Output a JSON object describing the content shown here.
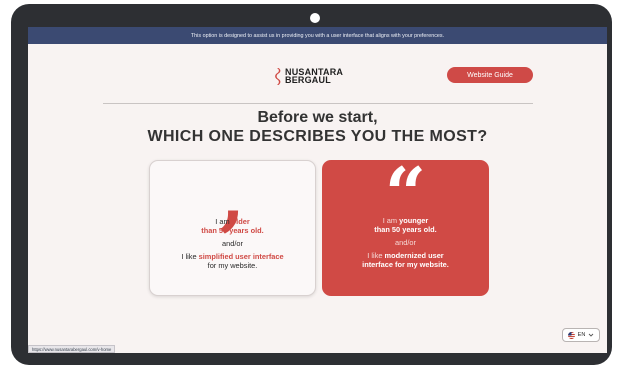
{
  "banner": {
    "text": "This option is designed to assist us in providing you with a user interface that aligns with your preferences."
  },
  "logo": {
    "line1": "NUSANTARA",
    "line2": "BERGAUL"
  },
  "header": {
    "guide_label": "Website Guide"
  },
  "main": {
    "heading_line1": "Before we start,",
    "heading_line2": "WHICH ONE DESCRIBES YOU THE MOST?"
  },
  "options": [
    {
      "quote": ",",
      "t1": "I am ",
      "t1_accent": "older",
      "t2_accent": "than 50 years old.",
      "t3": "and/or",
      "t4": "I like ",
      "t4_accent": "simplified user interface",
      "t5": "for my website."
    },
    {
      "quote": "“",
      "t1": "I am ",
      "t1_accent": "younger",
      "t2_accent": "than 50 years old.",
      "t3": "and/or",
      "t4": "I like ",
      "t4_accent": "modernized user",
      "t5": "interface for my website."
    }
  ],
  "status": {
    "url": "https://www.nusantarabergaul.com/v-home"
  },
  "language": {
    "selected": "EN"
  },
  "colors": {
    "brand_red": "#d04a45",
    "banner_navy": "#3b4a72",
    "page_bg": "#f8f3f2"
  },
  "icons": {
    "logo_mark": "brand-ribbon-icon",
    "flag": "us-flag-icon",
    "chevron": "chevron-down-icon"
  }
}
